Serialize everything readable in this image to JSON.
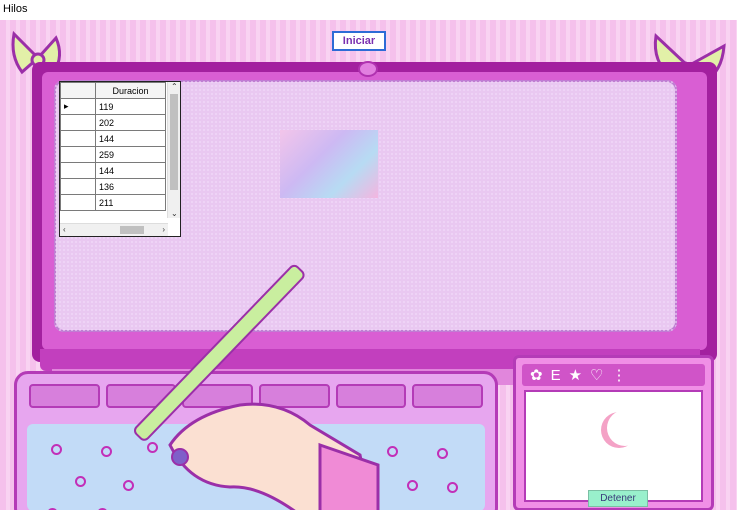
{
  "window": {
    "title": "Hilos"
  },
  "buttons": {
    "start_label": "Iniciar",
    "stop_label": "Detener"
  },
  "grid": {
    "column_header": "Duracion",
    "rows": [
      "119",
      "202",
      "144",
      "259",
      "144",
      "136",
      "211"
    ],
    "current_row_marker": "▸"
  },
  "colors": {
    "accent_purple": "#a3209f",
    "stop_button": "#99f0cc",
    "start_border": "#2d6bd6"
  },
  "icons": {
    "bow": "bow-decoration",
    "camera": "webcam-icon",
    "moon": "moon-icon"
  }
}
